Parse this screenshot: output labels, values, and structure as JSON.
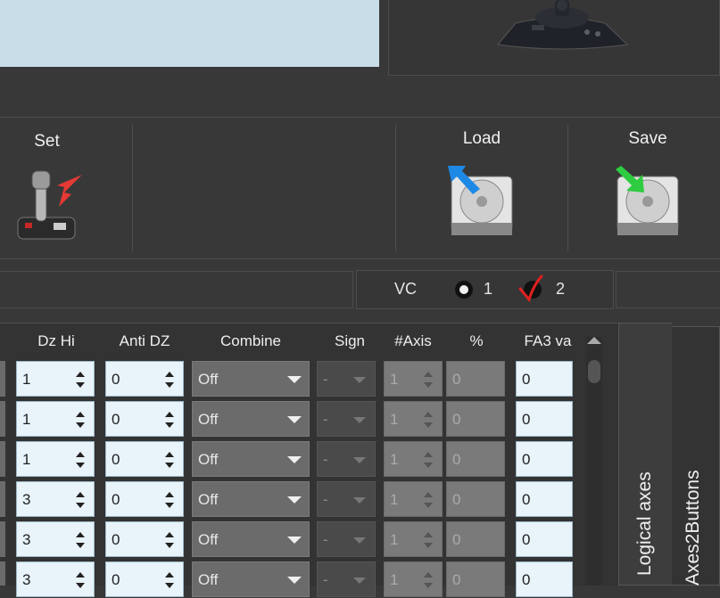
{
  "toolbar": {
    "set_label": "Set",
    "load_label": "Load",
    "save_label": "Save"
  },
  "vc": {
    "label": "VC",
    "option1": "1",
    "option2": "2",
    "selected": "2"
  },
  "table": {
    "headers": [
      "Dz Hi",
      "Anti DZ",
      "Combine",
      "Sign",
      "#Axis",
      "%",
      "FA3 va"
    ],
    "rows": [
      {
        "dzhi": "1",
        "antidz": "0",
        "combine": "Off",
        "sign": "-",
        "axis": "1",
        "pct": "0",
        "fa3": "0"
      },
      {
        "dzhi": "1",
        "antidz": "0",
        "combine": "Off",
        "sign": "-",
        "axis": "1",
        "pct": "0",
        "fa3": "0"
      },
      {
        "dzhi": "1",
        "antidz": "0",
        "combine": "Off",
        "sign": "-",
        "axis": "1",
        "pct": "0",
        "fa3": "0"
      },
      {
        "dzhi": "3",
        "antidz": "0",
        "combine": "Off",
        "sign": "-",
        "axis": "1",
        "pct": "0",
        "fa3": "0"
      },
      {
        "dzhi": "3",
        "antidz": "0",
        "combine": "Off",
        "sign": "-",
        "axis": "1",
        "pct": "0",
        "fa3": "0"
      },
      {
        "dzhi": "3",
        "antidz": "0",
        "combine": "Off",
        "sign": "-",
        "axis": "1",
        "pct": "0",
        "fa3": "0"
      }
    ]
  },
  "tabs": {
    "logical_axes": "Logical axes",
    "axes2buttons": "Axes2Buttons"
  },
  "colors": {
    "background": "#383838",
    "field": "#e8f4fa",
    "preview": "#c8dde8",
    "accent_red": "#e02020"
  }
}
